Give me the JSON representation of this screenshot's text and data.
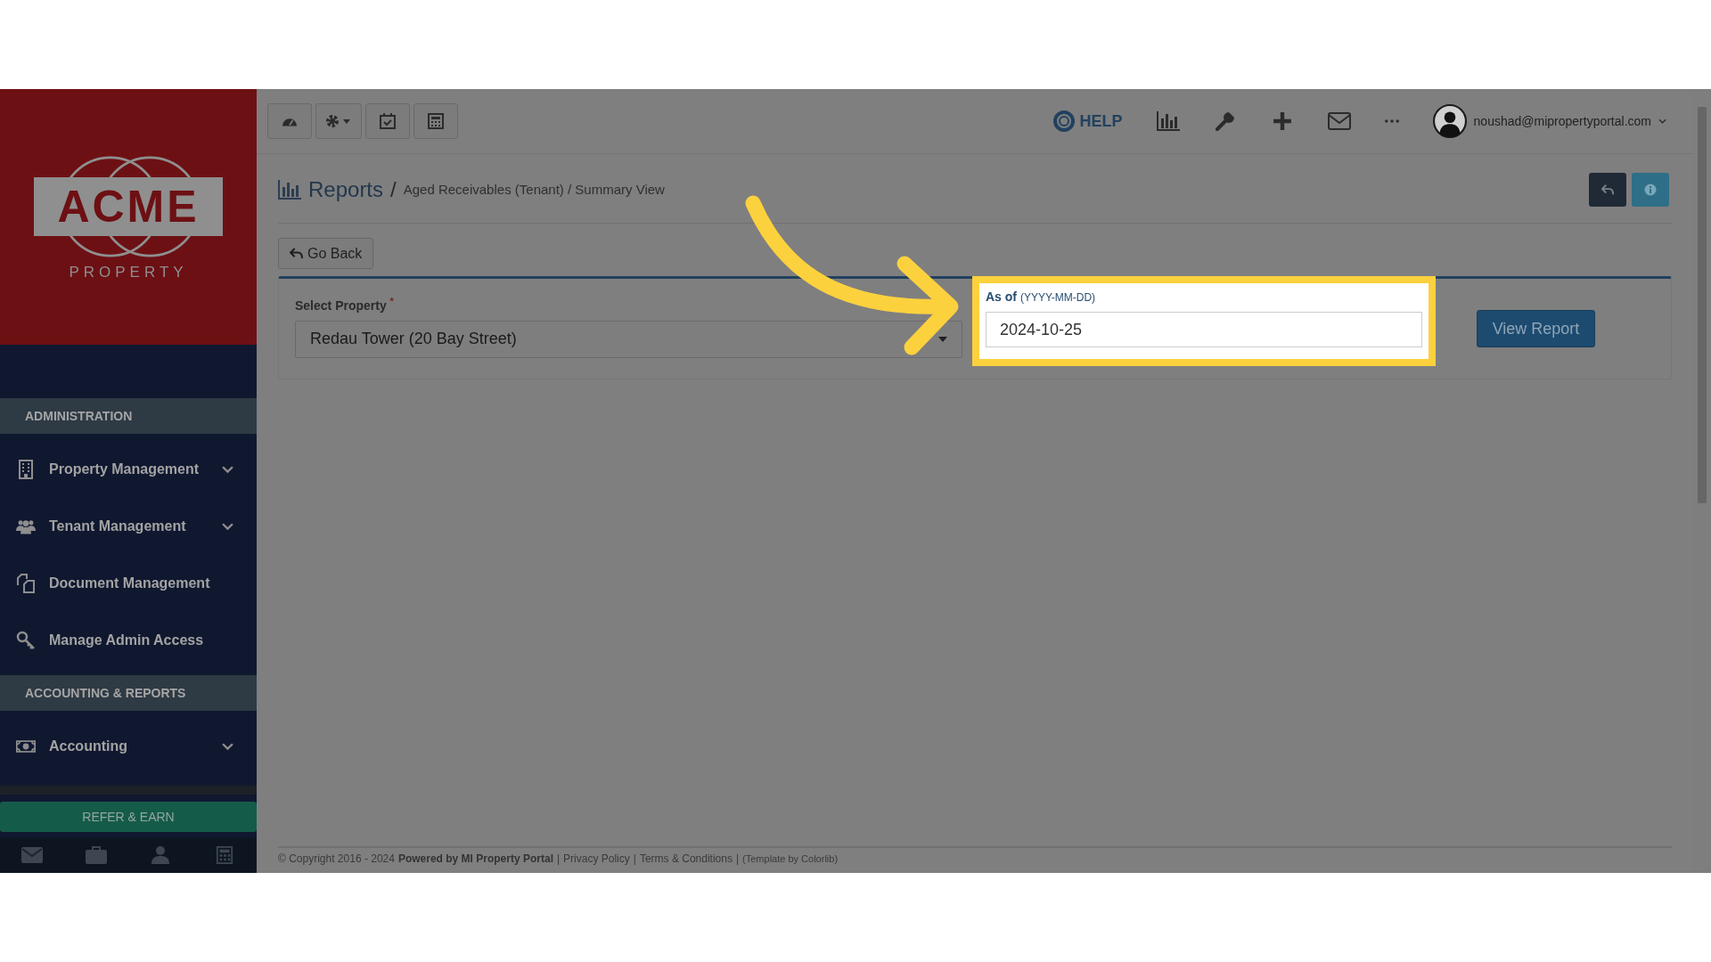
{
  "logo": {
    "name": "ACME",
    "sub": "PROPERTY"
  },
  "sidebar": {
    "sections": [
      {
        "title": "ADMINISTRATION",
        "items": [
          {
            "label": "Property Management",
            "expandable": true
          },
          {
            "label": "Tenant Management",
            "expandable": true
          },
          {
            "label": "Document Management",
            "expandable": false
          },
          {
            "label": "Manage Admin Access",
            "expandable": false
          }
        ]
      },
      {
        "title": "ACCOUNTING & REPORTS",
        "items": [
          {
            "label": "Accounting",
            "expandable": true
          }
        ]
      }
    ],
    "refer_button": "REFER & EARN"
  },
  "topbar": {
    "help": "HELP",
    "user": "noushad@mipropertyportal.com"
  },
  "breadcrumb": {
    "title": "Reports",
    "separator": "/",
    "path": "Aged Receivables (Tenant) / Summary View"
  },
  "go_back": "Go Back",
  "form": {
    "property": {
      "label": "Select Property",
      "required_mark": "*",
      "value": "Redau Tower (20 Bay Street)"
    },
    "as_of": {
      "label": "As of",
      "hint": "(YYYY-MM-DD)",
      "value": "2024-10-25",
      "highlighted": true
    },
    "submit": "View Report"
  },
  "footer": {
    "copyright": "© Copyright 2016 - 2024",
    "powered": "Powered by MI Property Portal",
    "separator": "|",
    "links": [
      "Privacy Policy",
      "Terms & Conditions"
    ],
    "template": "(Template by Colorlib)"
  }
}
